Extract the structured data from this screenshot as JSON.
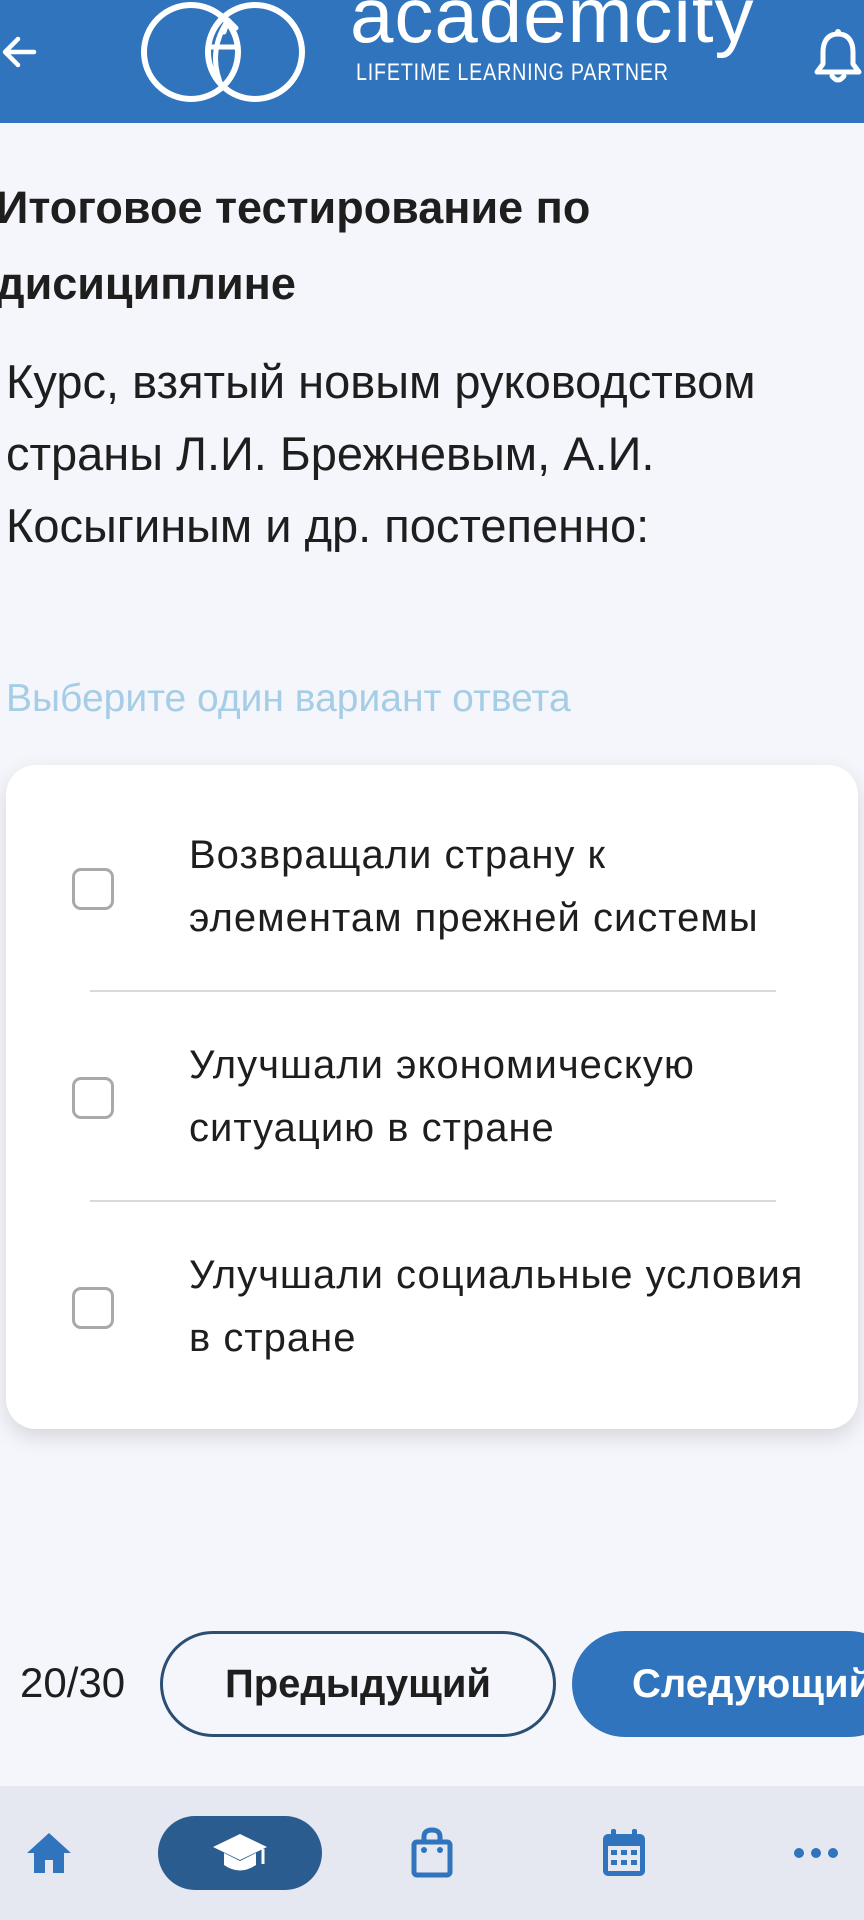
{
  "header": {
    "brand_name": "academcity",
    "brand_tagline": "LIFETIME LEARNING PARTNER",
    "background_color": "#2f74bd",
    "back_icon": "arrow-left-icon",
    "notification_icon": "bell-icon"
  },
  "test": {
    "title": "Итоговое тестирование по дисициплине",
    "question": "Курс, взятый новым руководством страны Л.И. Брежневым, А.И. Косыгиным и др. постепенно:",
    "hint": "Выберите один вариант ответа",
    "options": [
      {
        "label": "Возвращали страну к элементам прежней системы",
        "checked": false
      },
      {
        "label": "Улучшали экономическую ситуацию в стране",
        "checked": false
      },
      {
        "label": "Улучшали социальные условия в стране",
        "checked": false
      }
    ]
  },
  "pagination": {
    "counter": "20/30",
    "prev_label": "Предыдущий",
    "next_label": "Следующий"
  },
  "bottom_nav": {
    "items": [
      {
        "icon": "home-icon",
        "active": false
      },
      {
        "icon": "graduation-cap-icon",
        "active": true
      },
      {
        "icon": "shopping-bag-icon",
        "active": false
      },
      {
        "icon": "calendar-icon",
        "active": false
      },
      {
        "icon": "more-icon",
        "active": false
      }
    ],
    "active_color": "#2a5c8f"
  }
}
